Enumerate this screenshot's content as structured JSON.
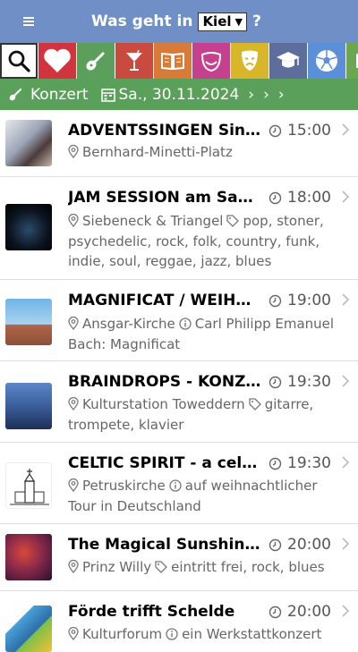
{
  "header": {
    "title_prefix": "Was geht in",
    "city": "Kiel",
    "title_suffix": "?"
  },
  "categories": [
    {
      "name": "search",
      "color": "#ffffff"
    },
    {
      "name": "heart",
      "color": "#d2343f"
    },
    {
      "name": "guitar",
      "color": "#5aa05a"
    },
    {
      "name": "cocktail",
      "color": "#c94a3f"
    },
    {
      "name": "book",
      "color": "#d87a38"
    },
    {
      "name": "mask-smile",
      "color": "#c7408f"
    },
    {
      "name": "theater",
      "color": "#d8b62a"
    },
    {
      "name": "graduation",
      "color": "#5d6d9c"
    },
    {
      "name": "football",
      "color": "#5b8fd8"
    },
    {
      "name": "more",
      "color": "#6aa84f"
    }
  ],
  "filter": {
    "category": "Konzert",
    "date": "Sa., 30.11.2024",
    "accent": "#5aa05a"
  },
  "events": [
    {
      "title": "ADVENTSSINGEN Sing´...",
      "time": "15:00",
      "location": "Bernhard-Minetti-Platz",
      "info": "",
      "tags": "",
      "continuation": "",
      "continuation2": ""
    },
    {
      "title": "JAM SESSION am Sams...",
      "time": "18:00",
      "location": "Siebeneck & Triangel",
      "info": "",
      "tags": "pop, stoner,",
      "continuation": "psychedelic, rock, folk, country, funk,",
      "continuation2": "indie, soul, reggae, jazz, blues"
    },
    {
      "title": "MAGNIFICAT / WEIHN...",
      "time": "19:00",
      "location": "Ansgar-Kirche",
      "info": "Carl Philipp Emanuel",
      "tags": "",
      "continuation": "Bach: Magnificat",
      "continuation2": ""
    },
    {
      "title": "BRAINDROPS - KONZERT",
      "time": "19:30",
      "location": "Kulturstation Toweddern",
      "info": "",
      "tags": "gitarre,",
      "continuation": "trompete, klavier",
      "continuation2": ""
    },
    {
      "title": "CELTIC SPIRIT - a celtic...",
      "time": "19:30",
      "location": "Petruskirche",
      "info": "auf weihnachtlicher",
      "tags": "",
      "continuation": "Tour in Deutschland",
      "continuation2": ""
    },
    {
      "title": "The Magical Sunshine ...",
      "time": "20:00",
      "location": "Prinz Willy",
      "info": "",
      "tags": "eintritt frei, rock, blues",
      "continuation": "",
      "continuation2": ""
    },
    {
      "title": "Förde trifft Schelde",
      "time": "20:00",
      "location": "Kulturforum",
      "info": "ein Werkstattkonzert",
      "tags": "",
      "continuation": "",
      "continuation2": ""
    }
  ]
}
